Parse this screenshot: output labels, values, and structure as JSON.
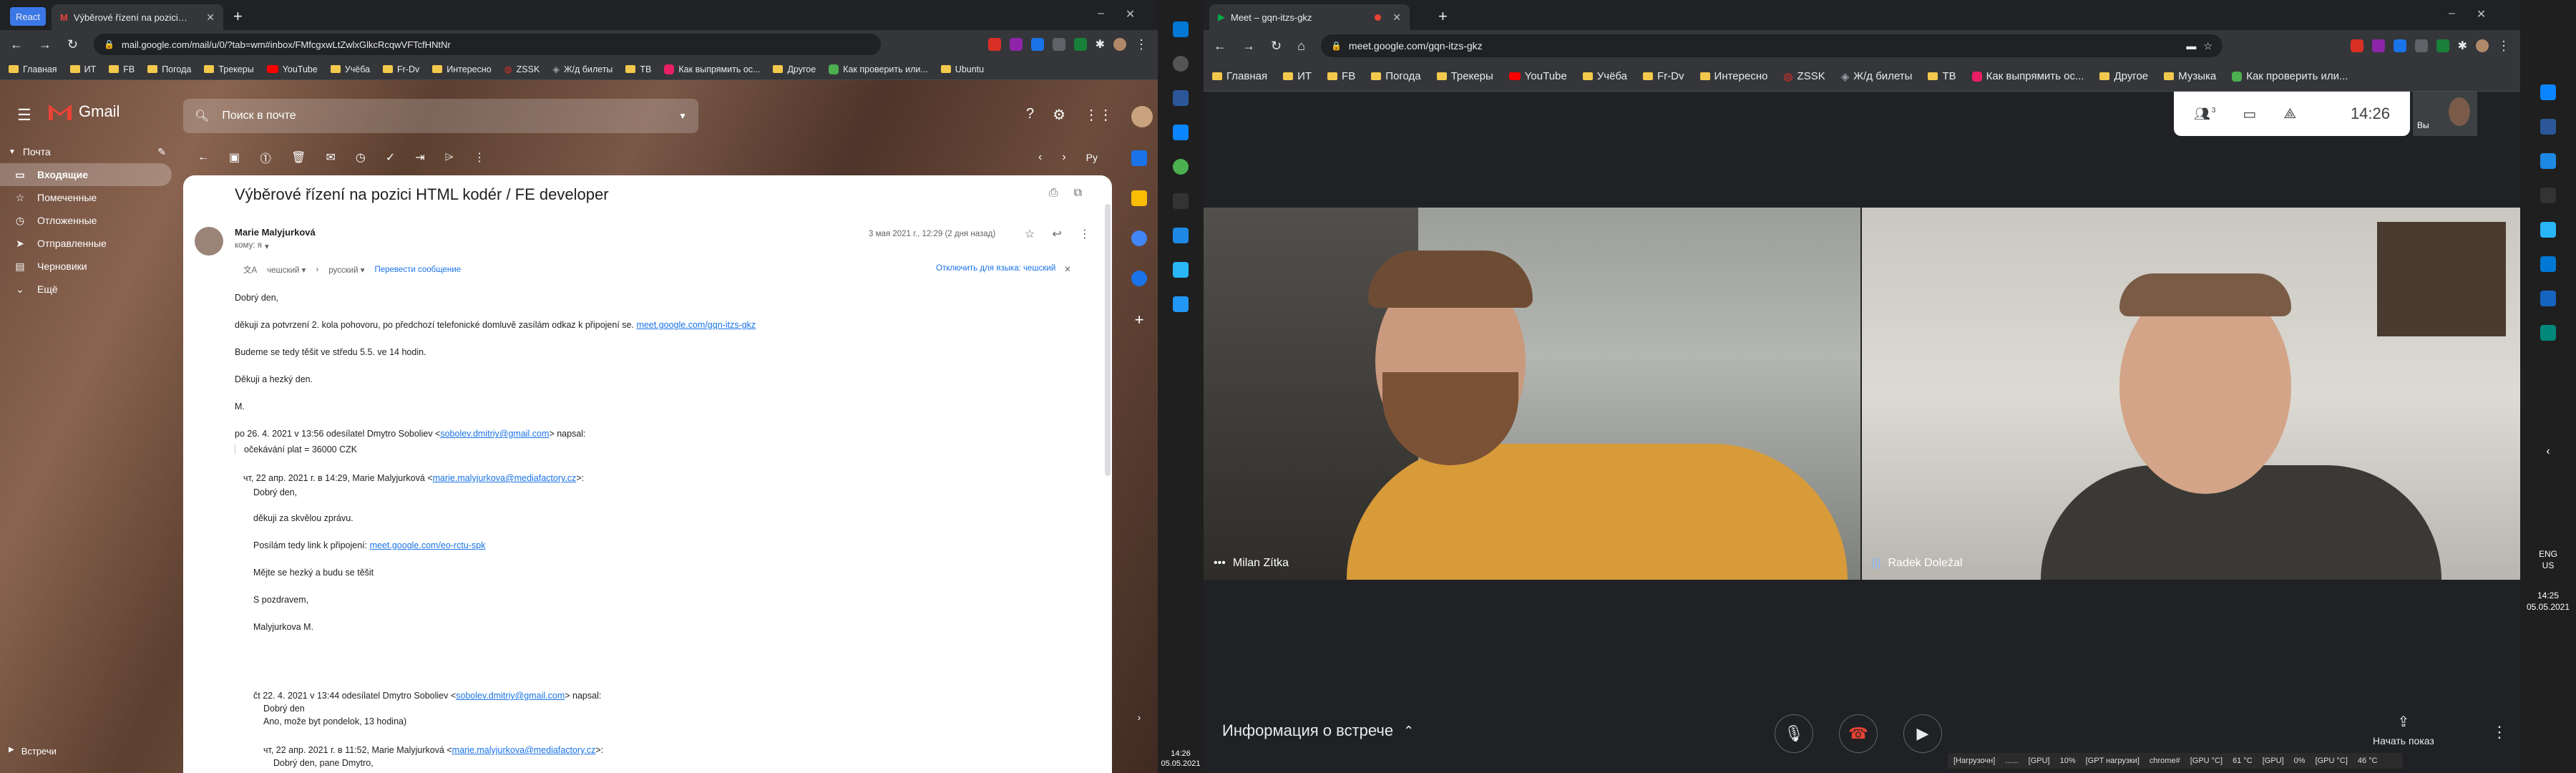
{
  "left_window": {
    "tabs": [
      {
        "label": "React",
        "active": false
      },
      {
        "label": "Výběrové řízení na pozici HTML",
        "active": true
      }
    ],
    "address": "mail.google.com/mail/u/0/?tab=wm#inbox/FMfcgxwLtZwlxGlkcRcqwVFTcfHNtNr",
    "bookmarks": [
      "Главная",
      "ИТ",
      "FB",
      "Погода",
      "Трекеры",
      "YouTube",
      "Учёба",
      "Fr-Dv",
      "Интересно",
      "ZSSK",
      "Ж/д билеты",
      "TB",
      "Как выпрямить ос...",
      "Другое",
      "Как проверить или...",
      "Ubuntu"
    ],
    "gmail": {
      "logo": "Gmail",
      "search_placeholder": "Поиск в почте",
      "sidebar_title": "Почта",
      "sidebar": [
        {
          "label": "Входящие",
          "active": true,
          "icon": "inbox-icon"
        },
        {
          "label": "Помеченные",
          "active": false,
          "icon": "star-icon"
        },
        {
          "label": "Отложенные",
          "active": false,
          "icon": "clock-icon"
        },
        {
          "label": "Отправленные",
          "active": false,
          "icon": "send-icon"
        },
        {
          "label": "Черновики",
          "active": false,
          "icon": "draft-icon"
        },
        {
          "label": "Ещё",
          "active": false,
          "icon": "chevron-down-icon"
        }
      ],
      "meet_label": "Встречи",
      "subject": "Výběrové řízení na pozici HTML kodér / FE developer",
      "sender": "Marie Malyjurková",
      "to_me": "кому: я",
      "date": "3 мая 2021 г., 12:29 (2 дня назад)",
      "translate_from": "чешский",
      "translate_to": "русский",
      "translate_action": "Перевести сообщение",
      "disable_translate": "Отключить для языка: чешский",
      "body": [
        "Dobrý den,",
        "děkuji za potvrzení 2. kola pohovoru, po předchozí telefonické domluvě zasílám odkaz k připojení se.",
        "Budeme se tedy těšit ve středu 5.5. ve 14 hodin.",
        "Děkuji a hezký den.",
        "M."
      ],
      "link1": "meet.google.com/gqn-itzs-gkz",
      "quote1_header_pre": "po 26. 4. 2021 v 13:56 odesílatel Dmytro Soboliev <",
      "quote1_email": "sobolev.dmitriy@gmail.com",
      "quote1_header_post": "> napsal:",
      "quote1_text": "očekávání plat  = 36000 CZK",
      "quote2_header_pre": "чт, 22 апр. 2021 г. в 14:29, Marie Malyjurková <",
      "quote2_email": "marie.malyjurkova@mediafactory.cz",
      "quote2_header_post": ">:",
      "quote2_body": [
        "Dobrý den,",
        "děkuji za skvělou zprávu.",
        "Mějte se hezký a budu se těšit",
        "S pozdravem,",
        "Malyjurkova M."
      ],
      "quote2_link_pre": "Posílám tedy link k připojení: ",
      "quote2_link": "meet.google.com/eo-rctu-spk",
      "quote3_header_pre": "čt 22. 4. 2021 v 13:44 odesílatel Dmytro Soboliev <",
      "quote3_email": "sobolev.dmitriy@gmail.com",
      "quote3_header_post": "> napsal:",
      "quote3_body": [
        "Dobrý den",
        "Ano, može byt pondelok, 13 hodina)"
      ],
      "quote4_header_pre": "чт, 22 апр. 2021 г. в 11:52, Marie Malyjurková <",
      "quote4_email": "marie.malyjurkova@mediafactory.cz",
      "quote4_header_post": ">:",
      "quote4_body": "Dobrý den, pane Dmytro,",
      "page_nav": "Ру"
    },
    "taskbar_clock": "14:26",
    "taskbar_date": "05.05.2021"
  },
  "right_window": {
    "tab_label": "Meet – gqn-itzs-gkz",
    "address": "meet.google.com/gqn-itzs-gkz",
    "bookmarks": [
      "Главная",
      "ИТ",
      "FB",
      "Погода",
      "Трекеры",
      "YouTube",
      "Учёба",
      "Fr-Dv",
      "Интересно",
      "ZSSK",
      "Ж/д билеты",
      "TB",
      "Как выпрямить ос...",
      "Другое",
      "Музыка",
      "Как проверить или..."
    ],
    "people_count": "3",
    "clock": "14:26",
    "self_label": "Вы",
    "participants": [
      {
        "name": "Milan Zítka"
      },
      {
        "name": "Radek Doležal"
      }
    ],
    "meeting_info": "Информация о встрече",
    "present": "Начать показ",
    "tray_lang": "ENG",
    "tray_lang2": "US",
    "tray_time": "14:25",
    "tray_date": "05.05.2021",
    "status_items": [
      "[Нагрузочн]",
      "......",
      "[GPU]",
      "10%",
      "[GPT нагрузки]",
      "chrome#",
      "[GPU °C]",
      "61 °C",
      "[GPU]",
      "0%",
      "[GPU °C]",
      "46 °C"
    ]
  }
}
